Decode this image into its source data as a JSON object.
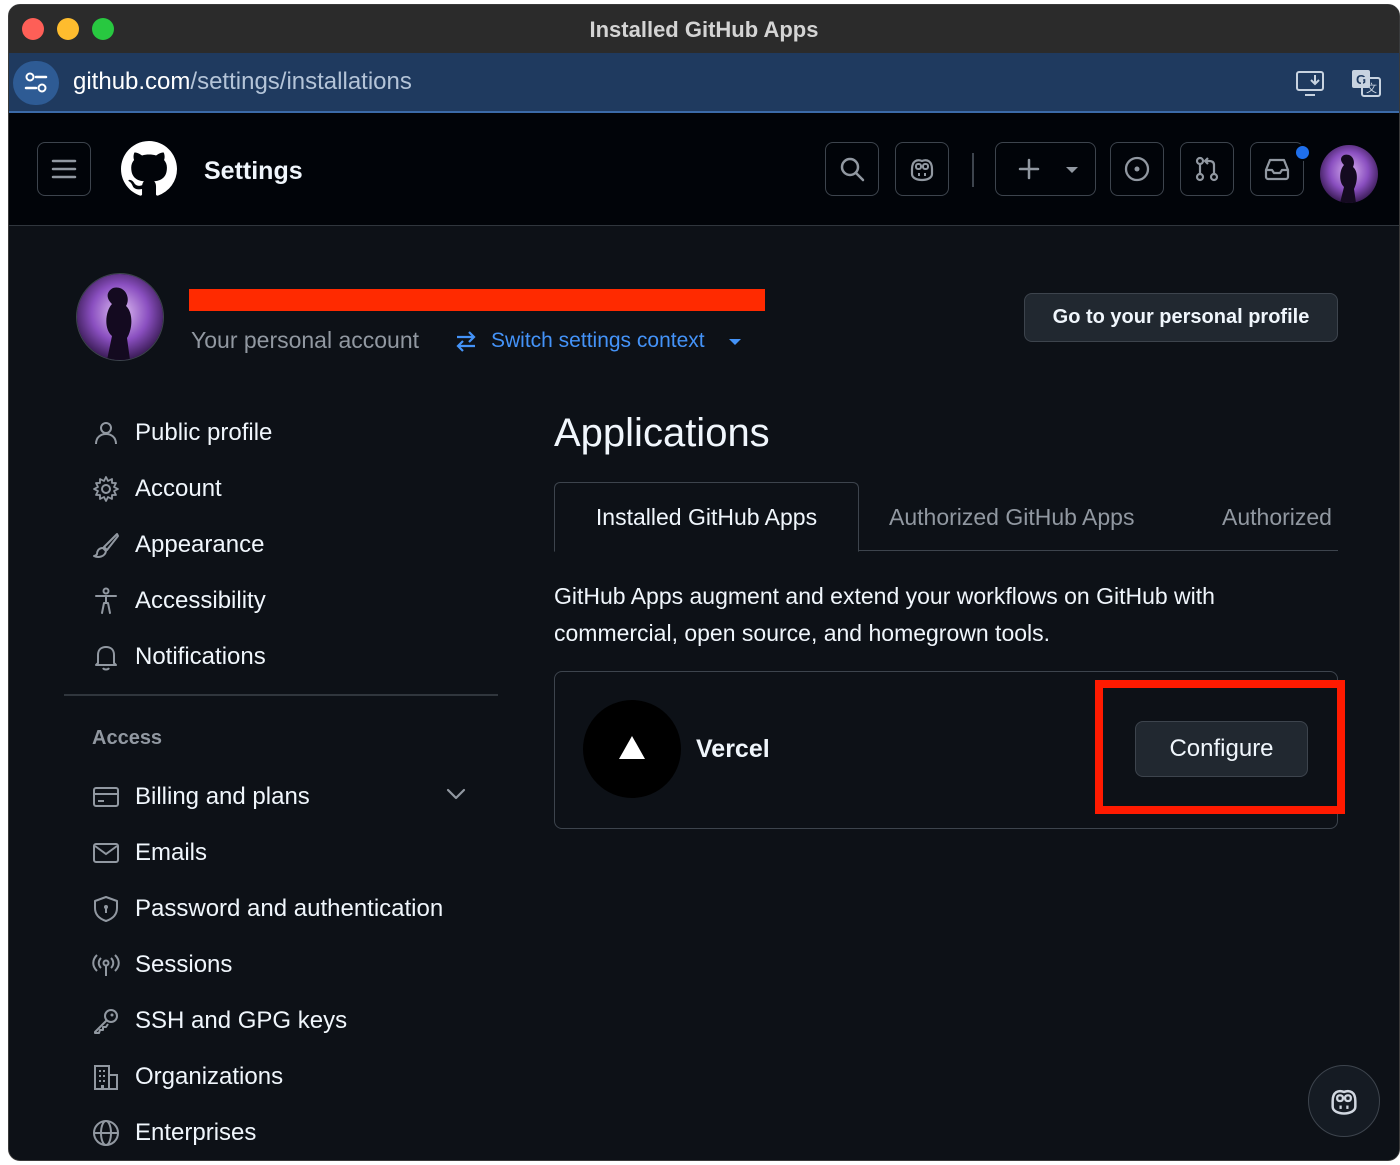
{
  "window": {
    "title": "Installed GitHub Apps"
  },
  "address_bar": {
    "domain": "github.com",
    "path": "/settings/installations"
  },
  "header": {
    "title": "Settings"
  },
  "account": {
    "name_redacted": "",
    "subtitle": "Your personal account",
    "switch_label": "Switch settings context",
    "profile_button": "Go to your personal profile"
  },
  "sidebar": {
    "items": [
      {
        "label": "Public profile",
        "icon": "person-icon"
      },
      {
        "label": "Account",
        "icon": "gear-icon"
      },
      {
        "label": "Appearance",
        "icon": "paintbrush-icon"
      },
      {
        "label": "Accessibility",
        "icon": "accessibility-icon"
      },
      {
        "label": "Notifications",
        "icon": "bell-icon"
      }
    ],
    "access_heading": "Access",
    "access_items": [
      {
        "label": "Billing and plans",
        "icon": "credit-card-icon"
      },
      {
        "label": "Emails",
        "icon": "mail-icon"
      },
      {
        "label": "Password and authentication",
        "icon": "shield-icon"
      },
      {
        "label": "Sessions",
        "icon": "broadcast-icon"
      },
      {
        "label": "SSH and GPG keys",
        "icon": "key-icon"
      },
      {
        "label": "Organizations",
        "icon": "organization-icon"
      },
      {
        "label": "Enterprises",
        "icon": "globe-icon"
      }
    ]
  },
  "main": {
    "title": "Applications",
    "tabs": [
      {
        "label": "Installed GitHub Apps",
        "active": true
      },
      {
        "label": "Authorized GitHub Apps",
        "active": false
      },
      {
        "label": "Authorized OAuth Apps",
        "active": false
      }
    ],
    "description": "GitHub Apps augment and extend your workflows on GitHub with commercial, open source, and homegrown tools.",
    "apps": [
      {
        "name": "Vercel",
        "button": "Configure"
      }
    ]
  },
  "colors": {
    "accent": "#4493f8",
    "highlight": "#ff1a00",
    "background": "#0d1117"
  }
}
